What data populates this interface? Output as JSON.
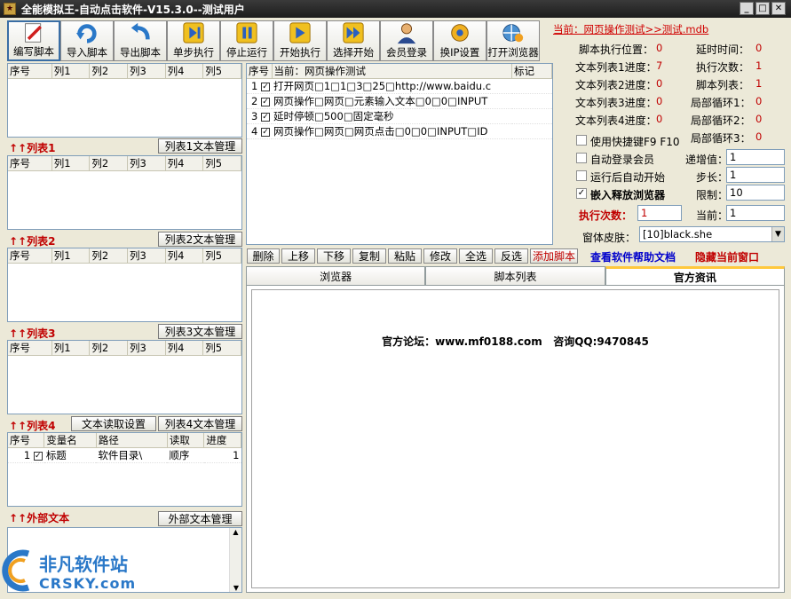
{
  "window": {
    "title": "全能模拟王-自动点击软件-V15.3.0--测试用户"
  },
  "toolbar": {
    "buttons": [
      "编写脚本",
      "导入脚本",
      "导出脚本",
      "单步执行",
      "停止运行",
      "开始执行",
      "选择开始",
      "会员登录",
      "换IP设置",
      "打开浏览器"
    ]
  },
  "current_db": "当前：网页操作测试>>测试.mdb",
  "list_headers": [
    "序号",
    "列1",
    "列2",
    "列3",
    "列4",
    "列5"
  ],
  "sections": {
    "list1": "↑↑列表1",
    "list1_btn": "列表1文本管理",
    "list2": "↑↑列表2",
    "list2_btn": "列表2文本管理",
    "list3": "↑↑列表3",
    "list3_btn": "列表3文本管理",
    "list4": "↑↑列表4",
    "list4_read_btn": "文本读取设置",
    "list4_btn": "列表4文本管理",
    "external": "↑↑外部文本",
    "external_btn": "外部文本管理"
  },
  "var_table": {
    "headers": [
      "序号",
      "变量名",
      "路径",
      "读取",
      "进度"
    ],
    "rows": [
      {
        "num": "1",
        "name": "标题",
        "path": "软件目录\\",
        "read": "顺序",
        "progress": "1"
      }
    ]
  },
  "script_table": {
    "headers": [
      "序号",
      "当前：网页操作测试",
      "标记"
    ],
    "rows": [
      {
        "num": "1",
        "text": "打开网页□1□1□3□25□http://www.baidu.c"
      },
      {
        "num": "2",
        "text": "网页操作□网页□元素输入文本□0□0□INPUT"
      },
      {
        "num": "3",
        "text": "延时停顿□500□固定毫秒"
      },
      {
        "num": "4",
        "text": "网页操作□网页□网页点击□0□0□INPUT□ID"
      }
    ]
  },
  "stats": {
    "exec_pos_label": "脚本执行位置：",
    "exec_pos": "0",
    "delay_label": "延时时间：",
    "delay": "0",
    "t1_label": "文本列表1进度：",
    "t1": "7",
    "exec_count_label": "执行次数：",
    "exec_count": "1",
    "t2_label": "文本列表2进度：",
    "t2": "0",
    "script_list_label": "脚本列表：",
    "script_list": "1",
    "t3_label": "文本列表3进度：",
    "t3": "0",
    "loop1_label": "局部循环1：",
    "loop1": "0",
    "t4_label": "文本列表4进度：",
    "t4": "0",
    "loop2_label": "局部循环2：",
    "loop2": "0",
    "loop3_label": "局部循环3：",
    "loop3": "0"
  },
  "options": {
    "hotkey": "使用快捷键F9 F10",
    "auto_login": "自动登录会员",
    "auto_start": "运行后自动开始",
    "embed_browser": "嵌入释放浏览器",
    "increment_label": "递增值：",
    "increment": "1",
    "step_label": "步长：",
    "step": "1",
    "limit_label": "限制：",
    "limit": "10",
    "exec_times_label": "执行次数：",
    "exec_times": "1",
    "current_label": "当前：",
    "current": "1",
    "skin_label": "窗体皮肤：",
    "skin": "[10]black.she"
  },
  "edit_buttons": [
    "删除",
    "上移",
    "下移",
    "复制",
    "粘贴",
    "修改",
    "全选",
    "反选",
    "添加脚本"
  ],
  "links": {
    "help": "查看软件帮助文档",
    "hide": "隐藏当前窗口"
  },
  "tabs": [
    "浏览器",
    "脚本列表",
    "官方资讯"
  ],
  "info": {
    "text": "官方论坛：www.mf0188.com   咨询QQ:9470845"
  },
  "watermark": {
    "cn": "非凡软件站",
    "en": "CRSKY.com"
  },
  "colors": {
    "red": "#c00000",
    "link_blue": "#0000cc"
  }
}
